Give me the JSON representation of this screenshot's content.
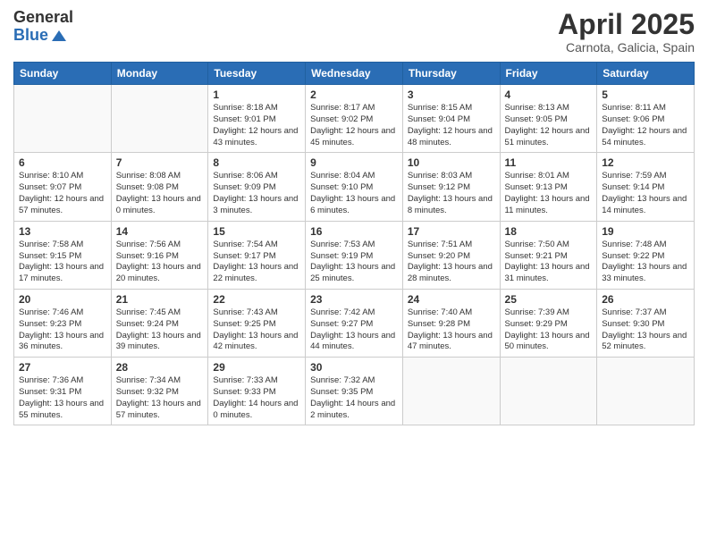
{
  "header": {
    "logo_general": "General",
    "logo_blue": "Blue",
    "main_title": "April 2025",
    "subtitle": "Carnota, Galicia, Spain"
  },
  "calendar": {
    "days_of_week": [
      "Sunday",
      "Monday",
      "Tuesday",
      "Wednesday",
      "Thursday",
      "Friday",
      "Saturday"
    ],
    "weeks": [
      [
        {
          "day": "",
          "info": ""
        },
        {
          "day": "",
          "info": ""
        },
        {
          "day": "1",
          "info": "Sunrise: 8:18 AM\nSunset: 9:01 PM\nDaylight: 12 hours and 43 minutes."
        },
        {
          "day": "2",
          "info": "Sunrise: 8:17 AM\nSunset: 9:02 PM\nDaylight: 12 hours and 45 minutes."
        },
        {
          "day": "3",
          "info": "Sunrise: 8:15 AM\nSunset: 9:04 PM\nDaylight: 12 hours and 48 minutes."
        },
        {
          "day": "4",
          "info": "Sunrise: 8:13 AM\nSunset: 9:05 PM\nDaylight: 12 hours and 51 minutes."
        },
        {
          "day": "5",
          "info": "Sunrise: 8:11 AM\nSunset: 9:06 PM\nDaylight: 12 hours and 54 minutes."
        }
      ],
      [
        {
          "day": "6",
          "info": "Sunrise: 8:10 AM\nSunset: 9:07 PM\nDaylight: 12 hours and 57 minutes."
        },
        {
          "day": "7",
          "info": "Sunrise: 8:08 AM\nSunset: 9:08 PM\nDaylight: 13 hours and 0 minutes."
        },
        {
          "day": "8",
          "info": "Sunrise: 8:06 AM\nSunset: 9:09 PM\nDaylight: 13 hours and 3 minutes."
        },
        {
          "day": "9",
          "info": "Sunrise: 8:04 AM\nSunset: 9:10 PM\nDaylight: 13 hours and 6 minutes."
        },
        {
          "day": "10",
          "info": "Sunrise: 8:03 AM\nSunset: 9:12 PM\nDaylight: 13 hours and 8 minutes."
        },
        {
          "day": "11",
          "info": "Sunrise: 8:01 AM\nSunset: 9:13 PM\nDaylight: 13 hours and 11 minutes."
        },
        {
          "day": "12",
          "info": "Sunrise: 7:59 AM\nSunset: 9:14 PM\nDaylight: 13 hours and 14 minutes."
        }
      ],
      [
        {
          "day": "13",
          "info": "Sunrise: 7:58 AM\nSunset: 9:15 PM\nDaylight: 13 hours and 17 minutes."
        },
        {
          "day": "14",
          "info": "Sunrise: 7:56 AM\nSunset: 9:16 PM\nDaylight: 13 hours and 20 minutes."
        },
        {
          "day": "15",
          "info": "Sunrise: 7:54 AM\nSunset: 9:17 PM\nDaylight: 13 hours and 22 minutes."
        },
        {
          "day": "16",
          "info": "Sunrise: 7:53 AM\nSunset: 9:19 PM\nDaylight: 13 hours and 25 minutes."
        },
        {
          "day": "17",
          "info": "Sunrise: 7:51 AM\nSunset: 9:20 PM\nDaylight: 13 hours and 28 minutes."
        },
        {
          "day": "18",
          "info": "Sunrise: 7:50 AM\nSunset: 9:21 PM\nDaylight: 13 hours and 31 minutes."
        },
        {
          "day": "19",
          "info": "Sunrise: 7:48 AM\nSunset: 9:22 PM\nDaylight: 13 hours and 33 minutes."
        }
      ],
      [
        {
          "day": "20",
          "info": "Sunrise: 7:46 AM\nSunset: 9:23 PM\nDaylight: 13 hours and 36 minutes."
        },
        {
          "day": "21",
          "info": "Sunrise: 7:45 AM\nSunset: 9:24 PM\nDaylight: 13 hours and 39 minutes."
        },
        {
          "day": "22",
          "info": "Sunrise: 7:43 AM\nSunset: 9:25 PM\nDaylight: 13 hours and 42 minutes."
        },
        {
          "day": "23",
          "info": "Sunrise: 7:42 AM\nSunset: 9:27 PM\nDaylight: 13 hours and 44 minutes."
        },
        {
          "day": "24",
          "info": "Sunrise: 7:40 AM\nSunset: 9:28 PM\nDaylight: 13 hours and 47 minutes."
        },
        {
          "day": "25",
          "info": "Sunrise: 7:39 AM\nSunset: 9:29 PM\nDaylight: 13 hours and 50 minutes."
        },
        {
          "day": "26",
          "info": "Sunrise: 7:37 AM\nSunset: 9:30 PM\nDaylight: 13 hours and 52 minutes."
        }
      ],
      [
        {
          "day": "27",
          "info": "Sunrise: 7:36 AM\nSunset: 9:31 PM\nDaylight: 13 hours and 55 minutes."
        },
        {
          "day": "28",
          "info": "Sunrise: 7:34 AM\nSunset: 9:32 PM\nDaylight: 13 hours and 57 minutes."
        },
        {
          "day": "29",
          "info": "Sunrise: 7:33 AM\nSunset: 9:33 PM\nDaylight: 14 hours and 0 minutes."
        },
        {
          "day": "30",
          "info": "Sunrise: 7:32 AM\nSunset: 9:35 PM\nDaylight: 14 hours and 2 minutes."
        },
        {
          "day": "",
          "info": ""
        },
        {
          "day": "",
          "info": ""
        },
        {
          "day": "",
          "info": ""
        }
      ]
    ]
  }
}
